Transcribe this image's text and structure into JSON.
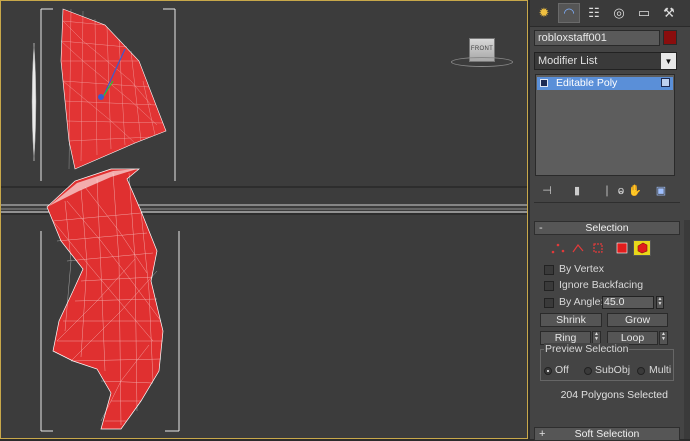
{
  "viewport": {
    "label": "Front viewport",
    "navcube_label": "FRONT"
  },
  "panel": {
    "tabs": [
      {
        "name": "create-tab-icon",
        "glyph": "✹"
      },
      {
        "name": "modify-tab-icon",
        "glyph": "◠"
      },
      {
        "name": "hierarchy-tab-icon",
        "glyph": "☷"
      },
      {
        "name": "motion-tab-icon",
        "glyph": "◎"
      },
      {
        "name": "display-tab-icon",
        "glyph": "▭"
      },
      {
        "name": "utilities-tab-icon",
        "glyph": "⚒"
      }
    ],
    "object_name": "robloxstaff001",
    "object_color": "#8a0d0d",
    "modifier_list": "Modifier List",
    "stack_items": [
      "Editable Poly"
    ],
    "selection": {
      "title": "Selection",
      "collapse_sign": "-",
      "subobject_icons": [
        "vertex-icon",
        "edge-icon",
        "border-icon",
        "polygon-icon",
        "element-icon"
      ],
      "active_subobject": "element-icon",
      "by_vertex": "By Vertex",
      "ignore_backfacing": "Ignore Backfacing",
      "by_angle": "By Angle:",
      "angle_value": "45.0",
      "shrink": "Shrink",
      "grow": "Grow",
      "ring": "Ring",
      "loop": "Loop",
      "preview_selection": "Preview Selection",
      "preview_options": [
        "Off",
        "SubObj",
        "Multi"
      ],
      "preview_selected": "Off",
      "status": "204 Polygons Selected"
    },
    "soft_selection": {
      "title": "Soft Selection",
      "collapse_sign": "+"
    }
  },
  "colors": {
    "accent_highlight": "#5a8fd8",
    "mesh_red": "#e03030",
    "viewport_border": "#c8a84a"
  }
}
